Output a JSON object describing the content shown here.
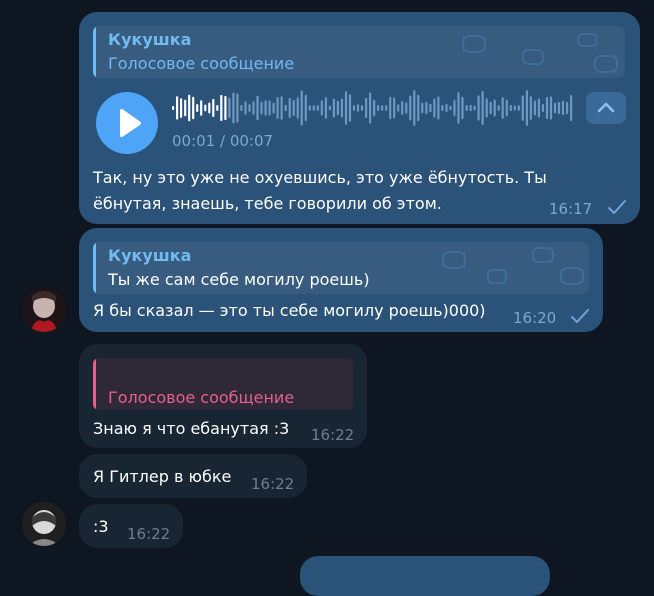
{
  "colors": {
    "background": "#0e1621",
    "outgoing_bubble": "#2b5278",
    "incoming_bubble": "#182533",
    "reply_name_blue": "#71baf2",
    "reply_pink": "#e4608e"
  },
  "messages": [
    {
      "reply": {
        "name": "Кукушка",
        "text": "Голосовое сообщение"
      },
      "voice": {
        "time": "00:01 / 00:07",
        "progress": 0.14
      },
      "text": "Так, ну это уже не охуевшись, это уже ёбнутость. Ты ёбнутая, знаешь, тебе говорили об этом.",
      "time": "16:17",
      "status": "check-icon"
    },
    {
      "reply": {
        "name": "Кукушка",
        "text": "Ты же сам себе могилу роешь)"
      },
      "text": "Я бы сказал — это ты себе могилу роешь)000)",
      "time": "16:20",
      "status": "check-icon"
    },
    {
      "reply": {
        "text": "Голосовое сообщение"
      },
      "text": "Знаю я что ебанутая :3",
      "time": "16:22"
    },
    {
      "text": "Я Гитлер в юбке",
      "time": "16:22"
    },
    {
      "text": ":3",
      "time": "16:22"
    }
  ]
}
